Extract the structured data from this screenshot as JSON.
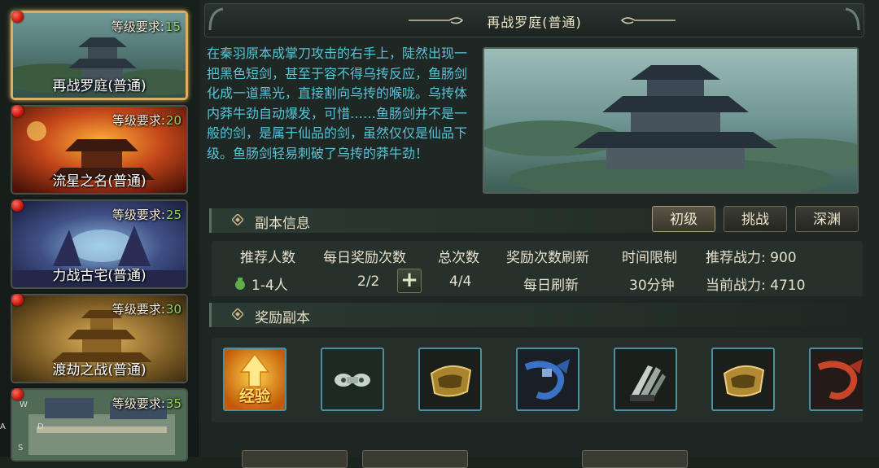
{
  "sidebar": {
    "items": [
      {
        "req_label": "等级要求:",
        "level": "15",
        "title": "再战罗庭(普通)"
      },
      {
        "req_label": "等级要求:",
        "level": "20",
        "title": "流星之名(普通)"
      },
      {
        "req_label": "等级要求:",
        "level": "25",
        "title": "力战古宅(普通)"
      },
      {
        "req_label": "等级要求:",
        "level": "30",
        "title": "渡劫之战(普通)"
      },
      {
        "req_label": "等级要求:",
        "level": "35",
        "title": ""
      }
    ],
    "edge_letters": [
      "W",
      "A",
      "D",
      "S"
    ]
  },
  "header": {
    "title": "再战罗庭(普通)"
  },
  "description": "在秦羽原本成掌刀攻击的右手上，陡然出现一把黑色短剑，甚至于容不得乌抟反应，鱼肠剑化成一道黑光，直接割向乌抟的喉咙。乌抟体内莽牛劲自动爆发，可惜……鱼肠剑并不是一般的剑，是属于仙品的剑，虽然仅仅是仙品下级。鱼肠剑轻易刺破了乌抟的莽牛劲！",
  "difficulty": {
    "tabs": [
      "初级",
      "挑战",
      "深渊"
    ],
    "selected": "初级"
  },
  "info_section": {
    "label": "副本信息",
    "headers": {
      "players": "推荐人数",
      "daily_rewards": "每日奖励次数",
      "total": "总次数",
      "refresh": "奖励次数刷新",
      "time_limit": "时间限制",
      "rec_power_label": "推荐战力:",
      "cur_power_label": "当前战力:"
    },
    "values": {
      "players": "1-4人",
      "daily_rewards": "2/2",
      "total": "4/4",
      "refresh": "每日刷新",
      "time_limit": "30分钟",
      "rec_power": "900",
      "cur_power": "4710"
    }
  },
  "reward_section": {
    "label": "奖励副本",
    "items": [
      {
        "icon": "exp-icon",
        "text": "经验"
      },
      {
        "icon": "silver-ornament-icon"
      },
      {
        "icon": "gold-bracer-icon"
      },
      {
        "icon": "blue-belt-icon"
      },
      {
        "icon": "claw-weapon-icon"
      },
      {
        "icon": "gold-bracer-icon"
      },
      {
        "icon": "red-belt-icon"
      }
    ]
  },
  "colors": {
    "accent_gold": "#d9b064",
    "text_cyan": "#58c4d6",
    "level_green": "#8bd85a",
    "badge_red": "#c3100a"
  }
}
